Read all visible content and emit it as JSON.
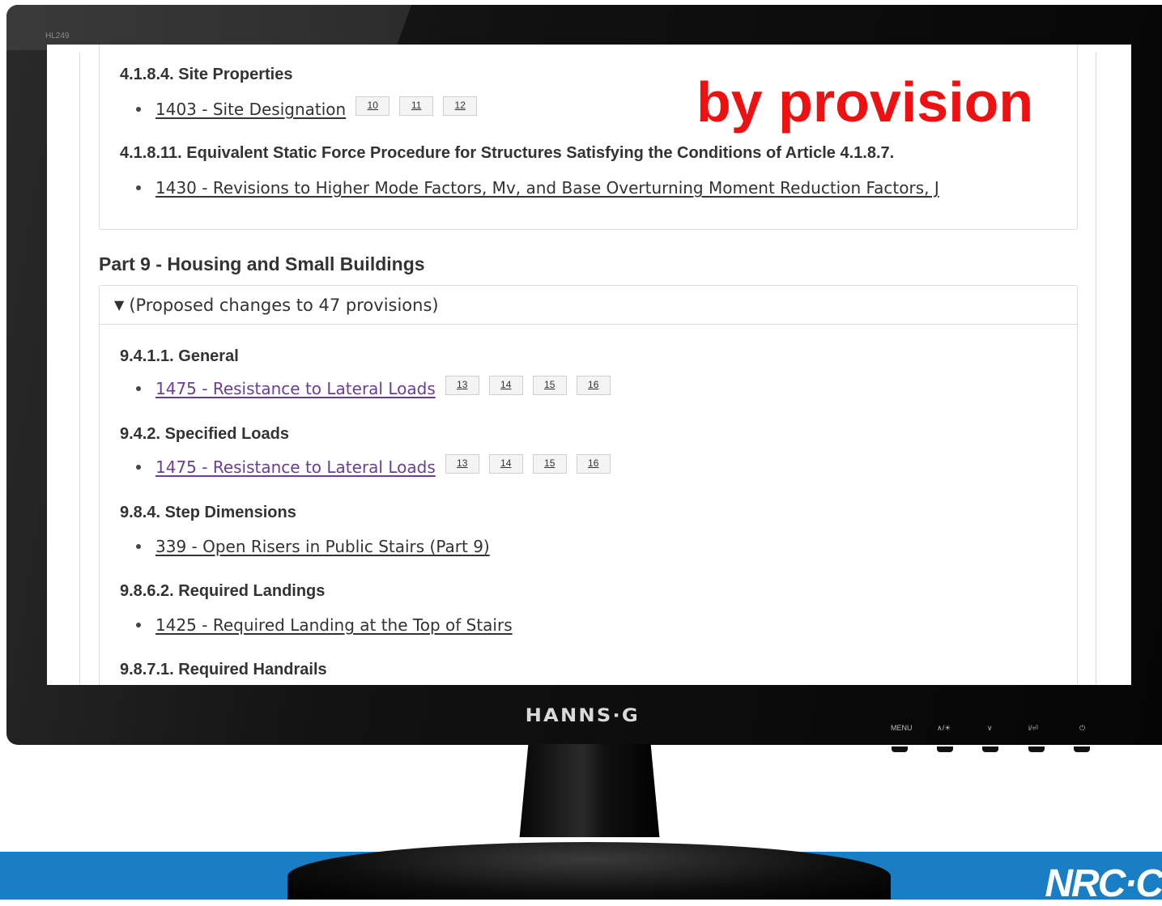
{
  "monitor": {
    "model_label": "HL249",
    "brand": "HANNS·G",
    "controls": [
      "MENU",
      "∧/☀",
      "∨",
      "i/⏎",
      "⏻"
    ]
  },
  "overlay_text": "by provision",
  "footer_logo": "NRC·C",
  "sections_top": [
    {
      "title": "4.1.8.4. Site Properties",
      "items": [
        {
          "label": "1403 - Site Designation",
          "badges": [
            "10",
            "11",
            "12"
          ],
          "visited": false
        }
      ]
    },
    {
      "title": "4.1.8.11. Equivalent Static Force Procedure for Structures Satisfying the Conditions of Article 4.1.8.7.",
      "items": [
        {
          "label": "1430 - Revisions to Higher Mode Factors, Mv, and Base Overturning Moment Reduction Factors, J",
          "badges": [],
          "visited": false
        }
      ]
    }
  ],
  "part9": {
    "title": "Part 9 - Housing and Small Buildings",
    "toggle_label": "(Proposed changes to 47 provisions)",
    "sections": [
      {
        "title": "9.4.1.1. General",
        "items": [
          {
            "label": "1475 - Resistance to Lateral Loads",
            "badges": [
              "13",
              "14",
              "15",
              "16"
            ],
            "visited": true
          }
        ]
      },
      {
        "title": "9.4.2. Specified Loads",
        "items": [
          {
            "label": "1475 - Resistance to Lateral Loads",
            "badges": [
              "13",
              "14",
              "15",
              "16"
            ],
            "visited": true
          }
        ]
      },
      {
        "title": "9.8.4. Step Dimensions",
        "items": [
          {
            "label": "339 - Open Risers in Public Stairs (Part 9)",
            "badges": [],
            "visited": false
          }
        ]
      },
      {
        "title": "9.8.6.2. Required Landings",
        "items": [
          {
            "label": "1425 - Required Landing at the Top of Stairs",
            "badges": [],
            "visited": false
          }
        ]
      },
      {
        "title": "9.8.7.1. Required Handrails",
        "items": []
      }
    ]
  }
}
